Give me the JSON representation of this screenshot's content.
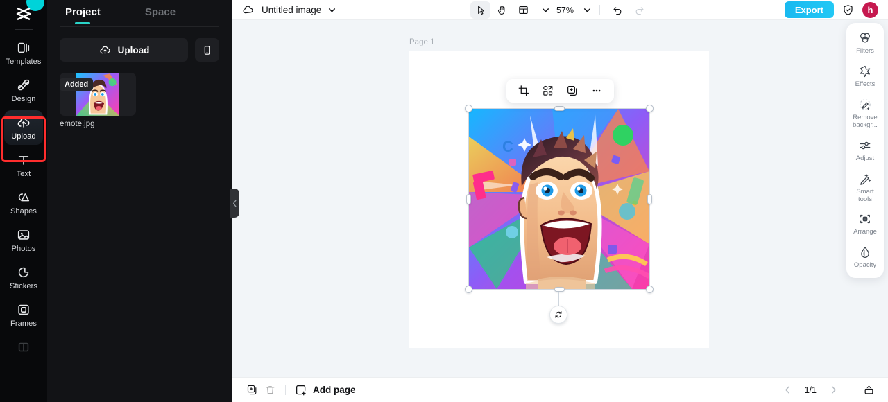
{
  "app": {
    "name": "CapCut",
    "logo_icon": "capcut-logo-icon"
  },
  "rail": {
    "items": [
      {
        "label": "Templates",
        "icon": "templates-icon",
        "active": false
      },
      {
        "label": "Design",
        "icon": "design-icon",
        "active": false
      },
      {
        "label": "Upload",
        "icon": "upload-cloud-icon",
        "active": true
      },
      {
        "label": "Text",
        "icon": "text-icon",
        "active": false
      },
      {
        "label": "Shapes",
        "icon": "shapes-icon",
        "active": false
      },
      {
        "label": "Photos",
        "icon": "photos-icon",
        "active": false
      },
      {
        "label": "Stickers",
        "icon": "stickers-icon",
        "active": false
      },
      {
        "label": "Frames",
        "icon": "frames-icon",
        "active": false
      }
    ],
    "highlight_color": "#ff2d2d",
    "highlighted_item": "Upload"
  },
  "panel": {
    "tabs": [
      {
        "label": "Project",
        "active": true
      },
      {
        "label": "Space",
        "active": false
      }
    ],
    "upload_button": {
      "label": "Upload",
      "icon": "upload-cloud-icon"
    },
    "device_button": {
      "icon": "mobile-device-icon"
    },
    "assets": [
      {
        "name": "emote.jpg",
        "badge": "Added"
      }
    ],
    "collapse_icon": "chevron-left-icon"
  },
  "topbar": {
    "cloud_icon": "cloud-sync-icon",
    "doc_title": "Untitled image",
    "title_caret_icon": "chevron-down-icon",
    "tools": [
      {
        "name": "select-tool",
        "icon": "cursor-arrow-icon",
        "selected": true
      },
      {
        "name": "hand-tool",
        "icon": "hand-icon",
        "selected": false
      },
      {
        "name": "layout-tool",
        "icon": "layout-grid-icon",
        "selected": false
      }
    ],
    "layout_caret_icon": "chevron-down-icon",
    "zoom_level": "57%",
    "zoom_caret_icon": "chevron-down-icon",
    "undo": {
      "icon": "undo-icon",
      "enabled": true
    },
    "redo": {
      "icon": "redo-icon",
      "enabled": false
    },
    "export_label": "Export",
    "export_color": "#1fc2f3",
    "shield_icon": "shield-check-icon",
    "avatar_initial": "h",
    "avatar_color": "#c6194f"
  },
  "canvas": {
    "page_label": "Page 1",
    "background": "#f2f5f8",
    "page_background": "#ffffff",
    "selected_object": "emote-image",
    "rotate_icon": "rotate-icon",
    "context_toolbar": [
      {
        "name": "crop-button",
        "icon": "crop-icon"
      },
      {
        "name": "replace-button",
        "icon": "replace-shapes-icon"
      },
      {
        "name": "duplicate-button",
        "icon": "duplicate-icon"
      },
      {
        "name": "more-button",
        "icon": "ellipsis-icon"
      }
    ]
  },
  "dock": {
    "items": [
      {
        "label": "Filters",
        "icon": "filters-icon"
      },
      {
        "label": "Effects",
        "icon": "effects-icon"
      },
      {
        "label": "Remove\nbackgr...",
        "icon": "remove-background-icon"
      },
      {
        "label": "Adjust",
        "icon": "adjust-sliders-icon"
      },
      {
        "label": "Smart\ntools",
        "icon": "smart-tools-icon"
      },
      {
        "label": "Arrange",
        "icon": "arrange-icon"
      },
      {
        "label": "Opacity",
        "icon": "opacity-icon"
      }
    ]
  },
  "bottombar": {
    "duplicate_page": {
      "icon": "duplicate-page-icon",
      "enabled": true
    },
    "delete_page": {
      "icon": "trash-icon",
      "enabled": false
    },
    "add_page_label": "Add page",
    "add_page_icon": "add-page-icon",
    "prev_icon": "chevron-left-icon",
    "page_indicator": "1/1",
    "next_icon": "chevron-right-icon",
    "present_icon": "present-icon"
  }
}
